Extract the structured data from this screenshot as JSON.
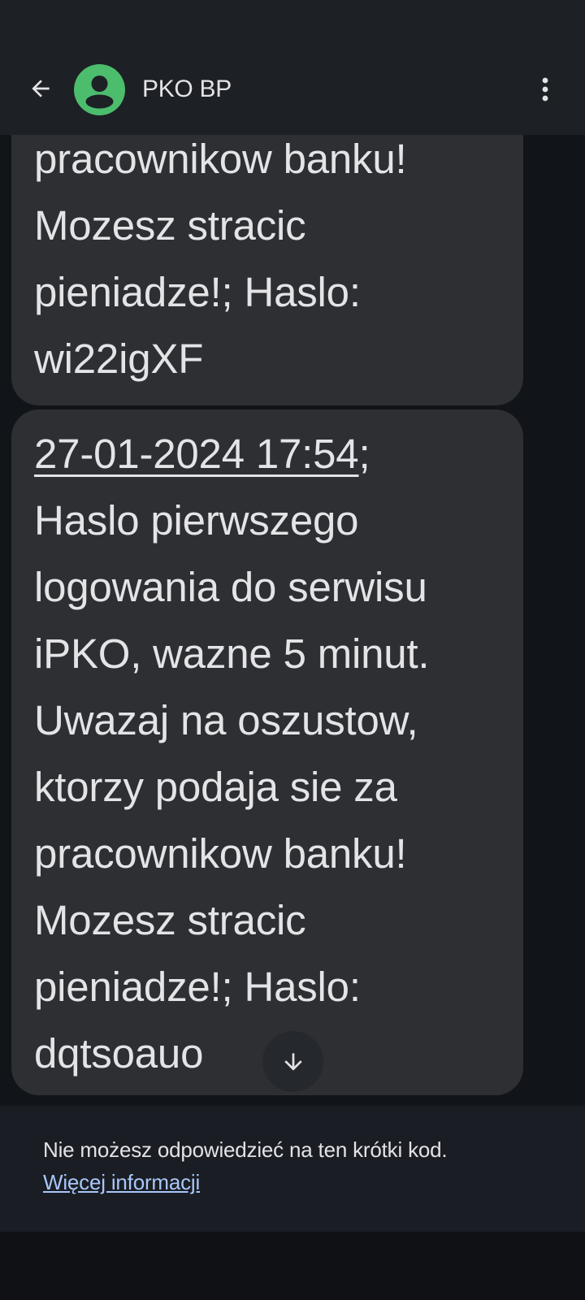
{
  "header": {
    "contact_name": "PKO BP",
    "back_icon": "arrow-left-icon",
    "avatar_icon": "person-icon",
    "more_icon": "more-vert-icon",
    "avatar_color": "#4cbc6d"
  },
  "messages": [
    {
      "text": "pracownikow banku!\nMozesz stracic\npieniadze!; Haslo:\nwi22igXF"
    },
    {
      "date": "27-01-2024 17:54",
      "text": ";\nHaslo pierwszego\nlogowania do serwisu\niPKO, wazne 5 minut.\nUwazaj na oszustow,\nktorzy podaja sie za\npracownikow banku!\nMozesz stracic\npieniadze!; Haslo:\ndqtsoauo"
    }
  ],
  "scroll_down_icon": "arrow-down-icon",
  "footer": {
    "note": "Nie możesz odpowiedzieć na ten krótki kod.",
    "link": "Więcej informacji",
    "link_color": "#a8c7fa"
  }
}
